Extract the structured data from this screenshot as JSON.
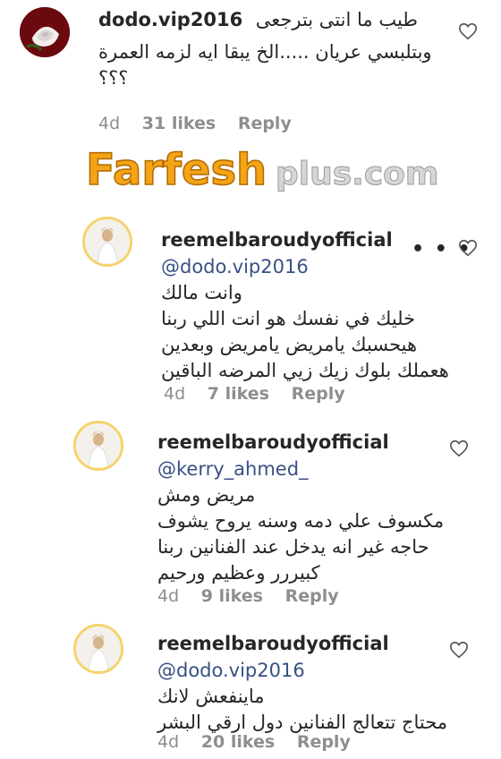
{
  "watermark": "Farfeshplus.com",
  "comments": [
    {
      "username": "dodo.vip2016",
      "lines": [
        "طيب ما انتى بترجعى",
        "وبتلبسي عريان .....الخ يبقا ايه لزمه العمرة",
        "؟؟؟"
      ],
      "time": "4d",
      "likes": "31 likes",
      "reply": "Reply"
    },
    {
      "username": "reemelbaroudyofficial",
      "mention": "@dodo.vip2016",
      "mention_suffix": "وانت مالك",
      "lines": [
        "خليك في نفسك هو انت اللي ربنا",
        "هيحسبك يامريض يامريض وبعدين",
        "هعملك بلوك زيك زيي المرضه الباقين"
      ],
      "time": "4d",
      "likes": "7 likes",
      "reply": "Reply"
    },
    {
      "username": "reemelbaroudyofficial",
      "mention": "@kerry_ahmed_",
      "mention_suffix": "مريض ومش",
      "lines": [
        "مكسوف علي دمه وسنه يروح يشوف",
        "حاجه غير انه يدخل عند الفنانين ربنا",
        "كبيررر وعظيم ورحيم"
      ],
      "time": "4d",
      "likes": "9 likes",
      "reply": "Reply"
    },
    {
      "username": "reemelbaroudyofficial",
      "mention": "@dodo.vip2016",
      "mention_suffix": "ماينفعش لانك",
      "lines": [
        "محتاج تتعالج الفنانين دول ارقي البشر"
      ],
      "time": "4d",
      "likes": "20 likes",
      "reply": "Reply"
    }
  ]
}
